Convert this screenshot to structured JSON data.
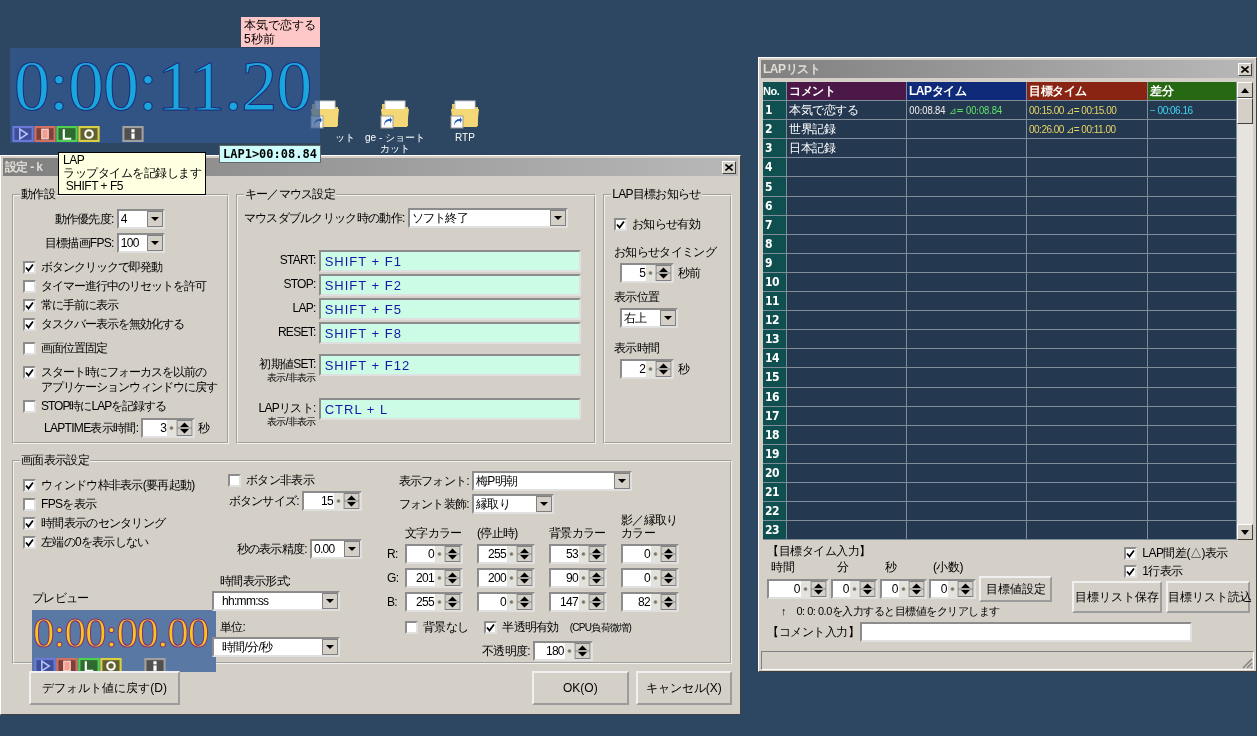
{
  "desktop": {
    "icons": [
      {
        "lines": [
          "ット"
        ]
      },
      {
        "lines": [
          "ge - ショート",
          "カット"
        ]
      },
      {
        "lines": [
          "RTP"
        ]
      }
    ]
  },
  "timer": {
    "time": "0:00:11.20",
    "buttons": [
      {
        "kind": "start"
      },
      {
        "kind": "stop"
      },
      {
        "kind": "lap"
      },
      {
        "kind": "reset"
      },
      {
        "kind": "info"
      }
    ]
  },
  "notice": {
    "lines": [
      "本気で恋する",
      "5秒前"
    ]
  },
  "lap_popup": {
    "text": "LAP1>00:08.84"
  },
  "tooltip": {
    "lines": [
      "LAP",
      "ラップタイムを記録します",
      " SHIFT + F5"
    ]
  },
  "settings": {
    "title": "設定 - k",
    "behavior": {
      "title": "動作設",
      "selects": [
        {
          "label": "動作優先度:",
          "value": "4"
        },
        {
          "label": "目標描画FPS:",
          "value": "100"
        }
      ],
      "checks": [
        {
          "label": "ボタンクリックで即発動",
          "checked": true
        },
        {
          "label": "タイマー進行中のリセットを許可",
          "checked": false
        },
        {
          "label": "常に手前に表示",
          "checked": true
        },
        {
          "label": "タスクバー表示を無効化する",
          "checked": true
        },
        {
          "label": "画面位置固定",
          "checked": false
        },
        {
          "lines": [
            "スタート時にフォーカスを以前の",
            "アプリケーションウィンドウに戻す"
          ],
          "checked": true
        },
        {
          "label": "STOP時にLAPを記録する",
          "checked": false
        }
      ],
      "laptime": {
        "label": "LAPTIME表示時間:",
        "value": "3",
        "unit": "秒"
      }
    },
    "keys": {
      "title": "キー／マウス設定",
      "dblclick": {
        "label": "マウスダブルクリック時の動作:",
        "value": "ソフト終了"
      },
      "bindings": [
        {
          "label": "START:",
          "value": "SHIFT + F1"
        },
        {
          "label": "STOP:",
          "value": "SHIFT + F2"
        },
        {
          "label": "LAP:",
          "value": "SHIFT + F5"
        },
        {
          "label": "RESET:",
          "value": "SHIFT + F8"
        },
        {
          "label": "初期値SET:",
          "sub": "表示/非表示",
          "value": "SHIFT + F12"
        },
        {
          "label": "LAPリスト:",
          "sub": "表示/非表示",
          "value": "CTRL + L"
        }
      ]
    },
    "notify": {
      "title": "LAP目標お知らせ",
      "enabled": {
        "label": "お知らせ有効",
        "checked": true
      },
      "timing": {
        "label": "お知らせタイミング",
        "value": "5",
        "unit": "秒前"
      },
      "position": {
        "label": "表示位置",
        "value": "右上"
      },
      "duration": {
        "label": "表示時間",
        "value": "2",
        "unit": "秒"
      }
    },
    "display": {
      "title": "画面表示設定",
      "checks": [
        {
          "label": "ウィンドウ枠非表示(要再起動)",
          "checked": true
        },
        {
          "label": "FPSを表示",
          "checked": false
        },
        {
          "label": "時間表示のセンタリング",
          "checked": true
        },
        {
          "label": "左端の0を表示しない",
          "checked": true
        }
      ],
      "preview": {
        "label": "プレビュー",
        "time": "0:00:00.00",
        "buttons": [
          {
            "kind": "start"
          },
          {
            "kind": "stop"
          },
          {
            "kind": "lap"
          },
          {
            "kind": "reset"
          },
          {
            "kind": "info"
          }
        ]
      },
      "hide_buttons": {
        "label": "ボタン非表示",
        "checked": false
      },
      "button_size": {
        "label": "ボタンサイズ:",
        "value": "15"
      },
      "precision": {
        "label": "秒の表示精度:",
        "value": "0.00"
      },
      "format": {
        "label": "時間表示形式:",
        "value": "hh:mm:ss"
      },
      "unit": {
        "label": "単位:",
        "value": "時間/分/秒"
      },
      "font": {
        "label": "表示フォント:",
        "value": "梅P明朝"
      },
      "decoration": {
        "label": "フォント装飾:",
        "value": "縁取り"
      },
      "color_headers": [
        {
          "lines": [
            "文字カラー"
          ]
        },
        {
          "lines": [
            "(停止時)"
          ]
        },
        {
          "lines": [
            "背景カラー"
          ]
        },
        {
          "lines": [
            "影／縁取り",
            "カラー"
          ]
        }
      ],
      "color_rows": [
        {
          "label": "R:",
          "values": [
            "0",
            "255",
            "53",
            "0"
          ]
        },
        {
          "label": "G:",
          "values": [
            "201",
            "200",
            "90",
            "0"
          ]
        },
        {
          "label": "B:",
          "values": [
            "255",
            "0",
            "147",
            "82"
          ]
        }
      ],
      "no_background": {
        "label": "背景なし",
        "checked": false
      },
      "translucent": {
        "label": "半透明有効",
        "note": "(CPU負荷微増)",
        "checked": true
      },
      "opacity": {
        "label": "不透明度:",
        "value": "180"
      }
    },
    "buttons": [
      {
        "label": "デフォルト値に戻す(D)"
      },
      {
        "label": "OK(O)"
      },
      {
        "label": "キャンセル(X)"
      }
    ]
  },
  "lap_list": {
    "title": "LAPリスト",
    "columns": [
      {
        "label": "No.",
        "color": "#0f4f4f"
      },
      {
        "label": "コメント",
        "color": "#4b1848"
      },
      {
        "label": "LAPタイム",
        "color": "#0f2a78"
      },
      {
        "label": "目標タイム",
        "color": "#8a2412"
      },
      {
        "label": "差分",
        "color": "#276812"
      }
    ],
    "rows": [
      {
        "no": "1",
        "comment": "本気で恋する",
        "lap": "00:08.84",
        "lap_delta": "⊿= 00:08.84",
        "target": "00:15.00 ⊿= 00:15.00",
        "diff": "− 00:06.16"
      },
      {
        "no": "2",
        "comment": "世界記録",
        "target": "00:26.00 ⊿= 00:11.00"
      },
      {
        "no": "3",
        "comment": "日本記録"
      },
      {
        "no": "4"
      },
      {
        "no": "5"
      },
      {
        "no": "6"
      },
      {
        "no": "7"
      },
      {
        "no": "8"
      },
      {
        "no": "9"
      },
      {
        "no": "10"
      },
      {
        "no": "11"
      },
      {
        "no": "12"
      },
      {
        "no": "13"
      },
      {
        "no": "14"
      },
      {
        "no": "15"
      },
      {
        "no": "16"
      },
      {
        "no": "17"
      },
      {
        "no": "18"
      },
      {
        "no": "19"
      },
      {
        "no": "20"
      },
      {
        "no": "21"
      },
      {
        "no": "22"
      },
      {
        "no": "23"
      }
    ],
    "target_input": {
      "title": "【目標タイム入力】",
      "fields": [
        {
          "label": "時間",
          "value": "0"
        },
        {
          "label": "分",
          "value": "0"
        },
        {
          "label": "秒",
          "value": "0"
        },
        {
          "label": "(小数)",
          "value": "0"
        }
      ],
      "set_button": "目標値設定",
      "hint": "↑　0: 0: 0.0を入力すると目標値をクリアします"
    },
    "options": [
      {
        "label": "LAP間差(△)表示",
        "checked": true
      },
      {
        "label": "1行表示",
        "checked": true
      }
    ],
    "buttons": [
      "目標リスト保存",
      "目標リスト読込"
    ],
    "comment": {
      "label": "【コメント入力】"
    }
  }
}
